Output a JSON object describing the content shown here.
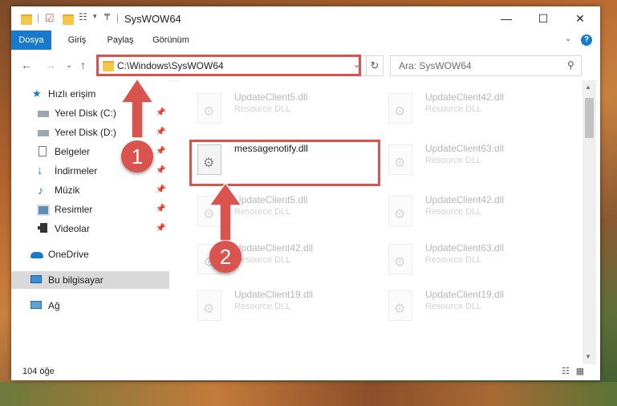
{
  "window": {
    "title": "SysWOW64",
    "controls": {
      "minimize": "—",
      "maximize": "☐",
      "close": "✕"
    }
  },
  "ribbon": {
    "tabs": [
      "Dosya",
      "Giriş",
      "Paylaş",
      "Görünüm"
    ],
    "expand_icon": "chevron-down-icon",
    "help_label": "?"
  },
  "address_bar": {
    "path": "C:\\Windows\\SysWOW64",
    "refresh": "↻",
    "dropdown": "⌄"
  },
  "search": {
    "placeholder": "Ara: SysWOW64"
  },
  "nav": {
    "back": "←",
    "forward": "→",
    "recent": "⌄",
    "up": "↑"
  },
  "sidebar": {
    "items": [
      {
        "label": "Hızlı erişim",
        "icon": "star-icon",
        "pinned": false
      },
      {
        "label": "Yerel Disk (C:)",
        "icon": "drive-icon",
        "pinned": true
      },
      {
        "label": "Yerel Disk (D:)",
        "icon": "drive-icon",
        "pinned": true
      },
      {
        "label": "Belgeler",
        "icon": "documents-icon",
        "pinned": true
      },
      {
        "label": "İndirmeler",
        "icon": "download-icon",
        "pinned": true
      },
      {
        "label": "Müzik",
        "icon": "music-icon",
        "pinned": true
      },
      {
        "label": "Resimler",
        "icon": "pictures-icon",
        "pinned": true
      },
      {
        "label": "Videolar",
        "icon": "video-icon",
        "pinned": true
      },
      {
        "label": "OneDrive",
        "icon": "cloud-icon",
        "pinned": false
      },
      {
        "label": "Bu bilgisayar",
        "icon": "computer-icon",
        "pinned": false
      },
      {
        "label": "Ağ",
        "icon": "network-icon",
        "pinned": false
      }
    ],
    "pin_glyph": "📌"
  },
  "files": {
    "highlighted": {
      "name": "messagenotify.dll",
      "desc": ""
    },
    "background": [
      {
        "name": "UpdateClient5.dll",
        "desc": "Resource DLL"
      },
      {
        "name": "UpdateClient42.dll",
        "desc": "Resource DLL"
      },
      {
        "name": "UpdateClient63.dll",
        "desc": "Resource DLL"
      },
      {
        "name": "UpdateClient5.dll",
        "desc": "Resource DLL"
      },
      {
        "name": "UpdateClient42.dll",
        "desc": "Resource DLL"
      },
      {
        "name": "UpdateClient42.dll",
        "desc": "Resource DLL"
      },
      {
        "name": "UpdateClient63.dll",
        "desc": "Resource DLL"
      },
      {
        "name": "UpdateClient19.dll",
        "desc": "Resource DLL"
      },
      {
        "name": "UpdateClient19.dll",
        "desc": "Resource DLL"
      }
    ]
  },
  "status": {
    "count": "104 öğe"
  },
  "annotations": {
    "step1": "1",
    "step2": "2",
    "color": "#d9534f"
  }
}
